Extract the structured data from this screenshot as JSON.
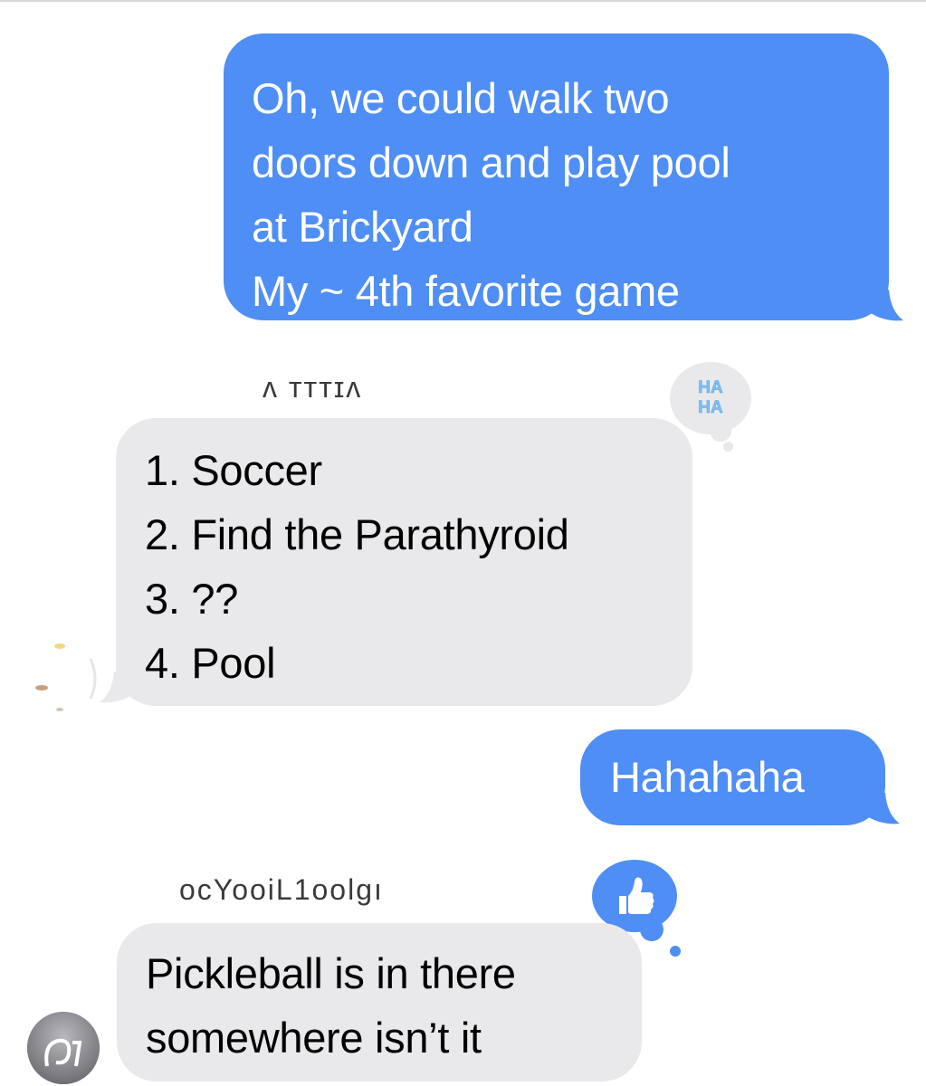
{
  "messages": [
    {
      "direction": "sent",
      "lines": [
        "Oh, we could walk two",
        "doors down and play pool",
        "at Brickyard",
        "My ~ 4th favorite game"
      ]
    },
    {
      "direction": "received",
      "sender": "ᴧ ᴛᴛᴛɪᴧ",
      "tapback": "haha",
      "tapback_text": "HA HA",
      "lines": [
        "1. Soccer",
        "2. Find the Parathyroid",
        "3. ??",
        "4. Pool"
      ]
    },
    {
      "direction": "sent",
      "lines": [
        "Hahahaha"
      ]
    },
    {
      "direction": "received",
      "sender": "ocYooiL1oolgı",
      "tapback": "thumbs-up",
      "tapback_text": "👍",
      "lines": [
        "Pickleball is in there",
        "somewhere isn’t it"
      ]
    }
  ],
  "colors": {
    "sent_bubble": "#4f8ef4",
    "received_bubble": "#e9e9eb",
    "tapback_haha_bg": "#e9e9eb",
    "tapback_like_bg": "#4f8ef4"
  }
}
